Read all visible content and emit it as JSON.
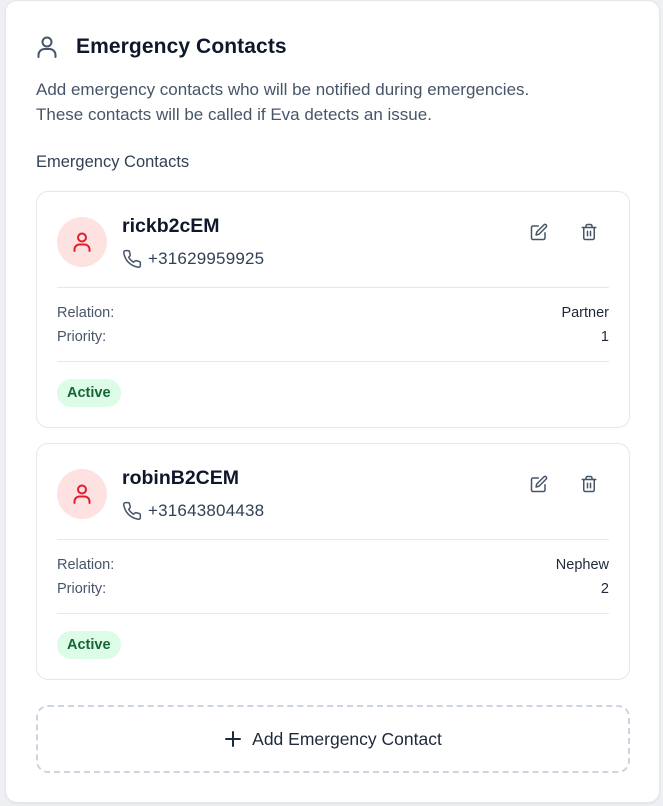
{
  "header": {
    "title": "Emergency Contacts",
    "icon": "user-icon",
    "description_line1": "Add emergency contacts who will be notified during emergencies.",
    "description_line2": "These contacts will be called if Eva detects an issue."
  },
  "section_label": "Emergency Contacts",
  "contacts": [
    {
      "name": "rickb2cEM",
      "phone": "+31629959925",
      "relation_label": "Relation:",
      "relation": "Partner",
      "priority_label": "Priority:",
      "priority": "1",
      "status": "Active"
    },
    {
      "name": "robinB2CEM",
      "phone": "+31643804438",
      "relation_label": "Relation:",
      "relation": "Nephew",
      "priority_label": "Priority:",
      "priority": "2",
      "status": "Active"
    }
  ],
  "add_button": {
    "label": "Add Emergency Contact",
    "icon": "plus-icon"
  },
  "colors": {
    "avatar_bg": "#fee2e2",
    "avatar_icon": "#e11d2e",
    "badge_bg": "#dcfce7",
    "badge_text": "#166534",
    "dashed_border": "#cbd5e1"
  }
}
